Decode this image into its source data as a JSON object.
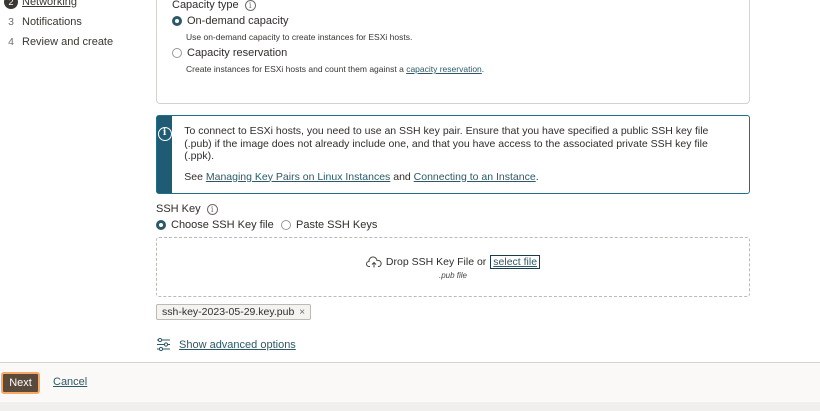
{
  "steps": [
    {
      "num": "2",
      "label": "Networking",
      "active": true
    },
    {
      "num": "3",
      "label": "Notifications"
    },
    {
      "num": "4",
      "label": "Review and create"
    }
  ],
  "capacity": {
    "label": "Capacity type",
    "options": [
      {
        "label": "On-demand capacity",
        "selected": true,
        "help": "Use on-demand capacity to create instances for ESXi hosts."
      },
      {
        "label": "Capacity reservation",
        "selected": false,
        "help_prefix": "Create instances for ESXi hosts and count them against a ",
        "help_link": "capacity reservation",
        "help_suffix": "."
      }
    ]
  },
  "banner": {
    "text": "To connect to ESXi hosts, you need to use an SSH key pair. Ensure that you have specified a public SSH key file (.pub) if the image does not already include one, and that you have access to the associated private SSH key file (.ppk).",
    "see": "See ",
    "link1": "Managing Key Pairs on Linux Instances",
    "and": " and ",
    "link2": "Connecting to an Instance",
    "end": "."
  },
  "ssh": {
    "label": "SSH Key",
    "option_choose": "Choose SSH Key file",
    "option_paste": "Paste SSH Keys",
    "drop_text": "Drop SSH Key File or",
    "select_file": "select file",
    "drop_sub": ".pub file",
    "chip": "ssh-key-2023-05-29.key.pub",
    "chip_remove": "×"
  },
  "advanced": "Show advanced options",
  "footer": {
    "next": "Next",
    "cancel": "Cancel"
  },
  "colors": {
    "accent": "#2c5967",
    "banner": "#1f5c73",
    "next_bg": "#5a4a3c",
    "focus": "#f6a866"
  }
}
